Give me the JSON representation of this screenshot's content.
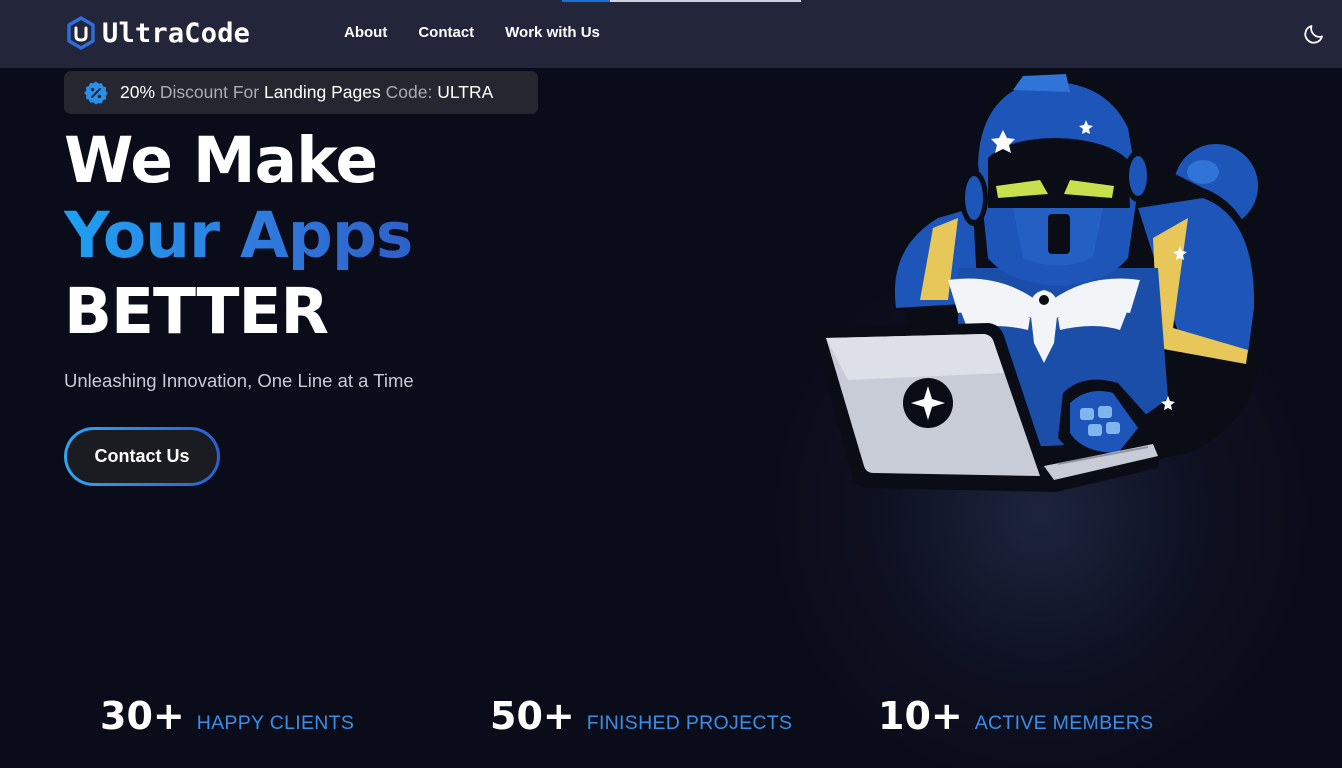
{
  "progress": {
    "value_percent": 20,
    "fill_color": "#1b6fd6"
  },
  "header": {
    "brand": "UltraCode",
    "nav": [
      {
        "label": "About"
      },
      {
        "label": "Contact"
      },
      {
        "label": "Work with Us"
      }
    ],
    "theme_toggle_icon": "moon-icon"
  },
  "promo": {
    "icon": "discount-badge-icon",
    "parts": [
      "20%",
      " Discount For ",
      "Landing Pages",
      " Code: ",
      "ULTRA"
    ]
  },
  "hero": {
    "line1": "We Make",
    "line2": "Your Apps",
    "line3": "BETTER",
    "tagline": "Unleashing Innovation, One Line at a Time",
    "cta_label": "Contact Us"
  },
  "mascot": {
    "icon": "armored-robot-laptop-mascot"
  },
  "stats": [
    {
      "value": "30+",
      "label": "HAPPY CLIENTS"
    },
    {
      "value": "50+",
      "label": "FINISHED PROJECTS"
    },
    {
      "value": "10+",
      "label": "ACTIVE MEMBERS"
    }
  ],
  "colors": {
    "background": "#0b0c1a",
    "navbar": "#23263a",
    "accent_blue": "#3a8fe6",
    "gradient_start": "#1ea0f0",
    "gradient_end": "#2e5fc8"
  }
}
